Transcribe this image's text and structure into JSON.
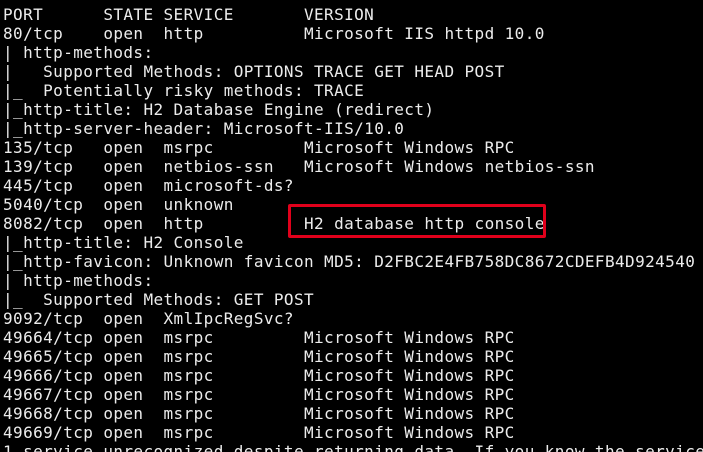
{
  "terminal": {
    "lines": [
      "PORT      STATE SERVICE       VERSION",
      "80/tcp    open  http          Microsoft IIS httpd 10.0",
      "| http-methods: ",
      "|   Supported Methods: OPTIONS TRACE GET HEAD POST",
      "|_  Potentially risky methods: TRACE",
      "|_http-title: H2 Database Engine (redirect)",
      "|_http-server-header: Microsoft-IIS/10.0",
      "135/tcp   open  msrpc         Microsoft Windows RPC",
      "139/tcp   open  netbios-ssn   Microsoft Windows netbios-ssn",
      "445/tcp   open  microsoft-ds?",
      "5040/tcp  open  unknown",
      "8082/tcp  open  http          H2 database http console",
      "|_http-title: H2 Console",
      "|_http-favicon: Unknown favicon MD5: D2FBC2E4FB758DC8672CDEFB4D924540",
      "| http-methods: ",
      "|_  Supported Methods: GET POST",
      "9092/tcp  open  XmlIpcRegSvc?",
      "49664/tcp open  msrpc         Microsoft Windows RPC",
      "49665/tcp open  msrpc         Microsoft Windows RPC",
      "49666/tcp open  msrpc         Microsoft Windows RPC",
      "49667/tcp open  msrpc         Microsoft Windows RPC",
      "49668/tcp open  msrpc         Microsoft Windows RPC",
      "49669/tcp open  msrpc         Microsoft Windows RPC",
      "1 service unrecognized despite returning data. If you know the service"
    ]
  },
  "colors": {
    "background": "#000000",
    "text": "#ececec",
    "highlight_border": "#e0001b"
  }
}
